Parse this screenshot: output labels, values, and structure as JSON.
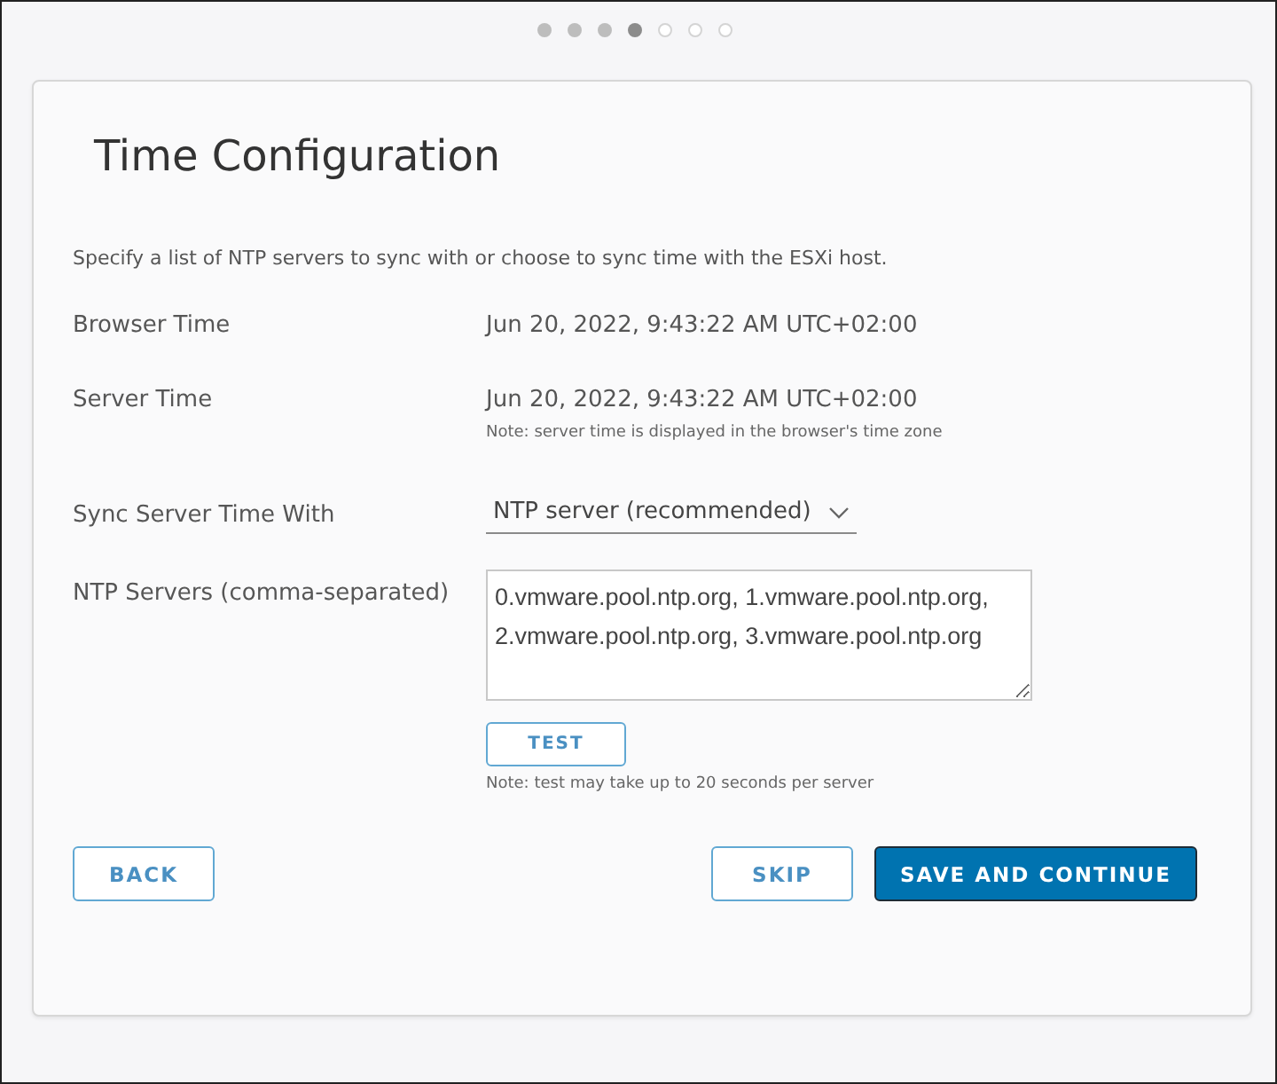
{
  "steps": [
    {
      "kind": "done"
    },
    {
      "kind": "done"
    },
    {
      "kind": "done"
    },
    {
      "kind": "current"
    },
    {
      "kind": "todo"
    },
    {
      "kind": "todo"
    },
    {
      "kind": "todo"
    }
  ],
  "title": "Time Configuration",
  "description": "Specify a list of NTP servers to sync with or choose to sync time with the ESXi host.",
  "browser_time": {
    "label": "Browser Time",
    "value": "Jun 20, 2022, 9:43:22 AM UTC+02:00"
  },
  "server_time": {
    "label": "Server Time",
    "value": "Jun 20, 2022, 9:43:22 AM UTC+02:00",
    "note": "Note: server time is displayed in the browser's time zone"
  },
  "sync_with": {
    "label": "Sync Server Time With",
    "value": "NTP server (recommended)"
  },
  "ntp_servers": {
    "label": "NTP Servers (comma-separated)",
    "value": "0.vmware.pool.ntp.org, 1.vmware.pool.ntp.org, 2.vmware.pool.ntp.org, 3.vmware.pool.ntp.org",
    "test_button": "TEST",
    "note": "Note: test may take up to 20 seconds per server"
  },
  "buttons": {
    "back": "BACK",
    "skip": "SKIP",
    "save": "SAVE AND CONTINUE"
  }
}
